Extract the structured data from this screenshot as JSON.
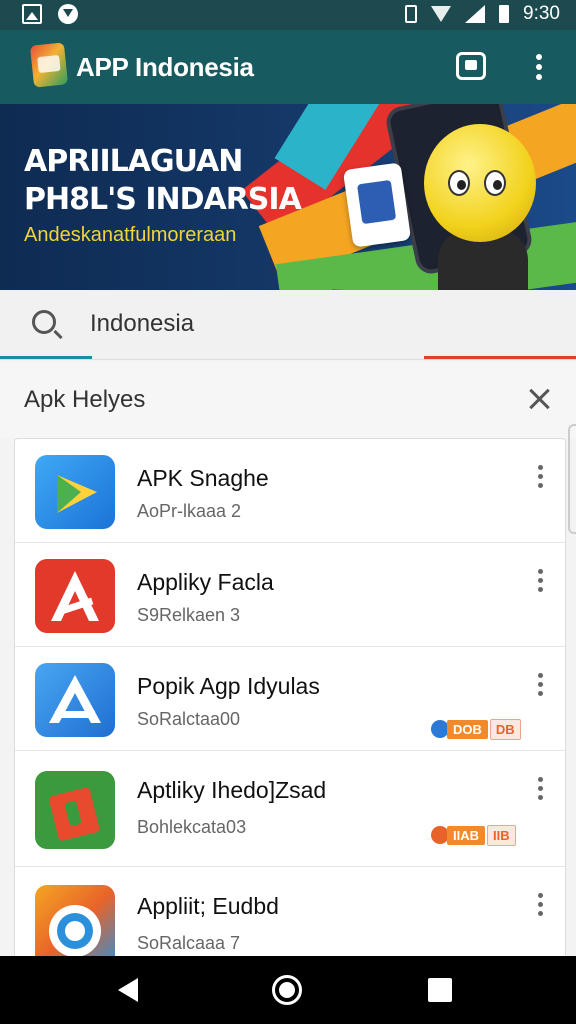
{
  "status_bar": {
    "time": "9:30",
    "icons": [
      "image-icon",
      "download-icon",
      "vibrate-icon",
      "wifi-icon",
      "signal-icon",
      "battery-icon"
    ]
  },
  "app_bar": {
    "title": "APP Indonesia",
    "logo_icon": "app-logo-icon",
    "actions": [
      "store-icon",
      "more-vert-icon"
    ],
    "color": "#175a5f"
  },
  "banner": {
    "line1": "APRIILAGUAN",
    "line2": "PH8L'S INDARSIA",
    "tagline": "Andeskanatfulmoreraan"
  },
  "search": {
    "value": "Indonesia"
  },
  "section": {
    "title": "Apk Helyes"
  },
  "apps": [
    {
      "name": "APK Snaghe",
      "subtitle": "AoPr-lkaaa 2",
      "icon": "play-triangle-icon",
      "badge": null
    },
    {
      "name": "Appliky Facla",
      "subtitle": "S9Relkaen 3",
      "icon": "red-a-icon",
      "badge": null
    },
    {
      "name": "Popik Agp Idyulas",
      "subtitle": "SoRalctaa00",
      "icon": "blue-a-icon",
      "badge": {
        "text": "DOB",
        "tag": "DB"
      }
    },
    {
      "name": "Aptliky Ihedo]Zsad",
      "subtitle": "Bohlekcata03",
      "icon": "green-red-icon",
      "badge": {
        "text": "IIAB",
        "tag": "IIB"
      }
    },
    {
      "name": "Appliit; Eudbd",
      "subtitle": "SoRalcaaa 7",
      "icon": "swirl-icon",
      "badge": null
    }
  ],
  "nav_bar": [
    "back-icon",
    "home-icon",
    "recent-apps-icon"
  ]
}
